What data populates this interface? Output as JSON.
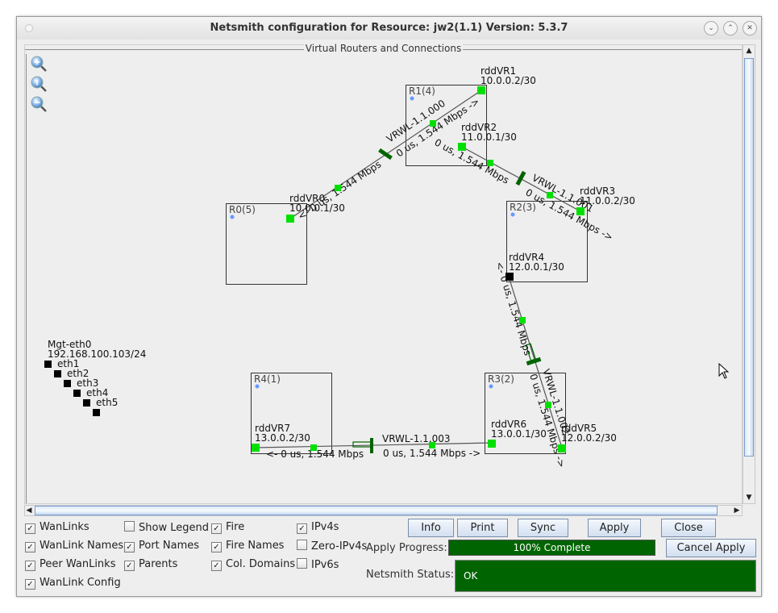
{
  "window": {
    "title": "Netsmith configuration for Resource:  jw2(1.1)  Version: 5.3.7",
    "controls": [
      "minimize",
      "maximize",
      "close"
    ],
    "control_glyphs": [
      "⌄",
      "⌃",
      "✕"
    ]
  },
  "panel": {
    "title": "Virtual Routers and Connections",
    "zoom_tools": [
      "zoom-in",
      "zoom-reset",
      "zoom-out"
    ]
  },
  "routers": [
    {
      "label": "R1(4)"
    },
    {
      "label": "R0(5)"
    },
    {
      "label": "R2(3)"
    },
    {
      "label": "R3(2)"
    },
    {
      "label": "R4(1)"
    }
  ],
  "ports": [
    {
      "name": "rddVR1",
      "ip": "10.0.0.2/30"
    },
    {
      "name": "rddVR2",
      "ip": "11.0.0.1/30"
    },
    {
      "name": "rddVR0",
      "ip": "10.0.0.1/30"
    },
    {
      "name": "rddVR3",
      "ip": "11.0.0.2/30"
    },
    {
      "name": "rddVR4",
      "ip": "12.0.0.1/30"
    },
    {
      "name": "rddVR6",
      "ip": "13.0.0.1/30"
    },
    {
      "name": "rddVR5",
      "ip": "12.0.0.2/30"
    },
    {
      "name": "rddVR7",
      "ip": "13.0.0.2/30"
    }
  ],
  "wanlinks": [
    {
      "name": "VRWL-1.1.000",
      "fwd": "0 us, 1.544 Mbps ->",
      "rev": "<- 0 us, 1.544 Mbps"
    },
    {
      "name": "VRWL-1.1.001",
      "fwd": "0 us, 1.544 Mbps ->",
      "rev": "0 us, 1.544 Mbps"
    },
    {
      "name": "VRWL-1.1.002",
      "fwd": "0 us, 1.544 Mbps ->",
      "rev": "<- 0 us, 1.544 Mbps"
    },
    {
      "name": "VRWL-1.1.003",
      "fwd": "0 us, 1.544 Mbps ->",
      "rev": "<- 0 us, 1.544 Mbps"
    }
  ],
  "mgmt": {
    "name": "Mgt-eth0",
    "ip": "192.168.100.103/24",
    "interfaces": [
      "eth1",
      "eth2",
      "eth3",
      "eth4",
      "eth5"
    ]
  },
  "checkboxes": [
    {
      "label": "WanLinks",
      "checked": true
    },
    {
      "label": "WanLink Names",
      "checked": true
    },
    {
      "label": "Peer WanLinks",
      "checked": true
    },
    {
      "label": "WanLink Config",
      "checked": true
    },
    {
      "label": "Show Legend",
      "checked": false
    },
    {
      "label": "Port Names",
      "checked": true
    },
    {
      "label": "Parents",
      "checked": true
    },
    {
      "label": "Fire",
      "checked": true
    },
    {
      "label": "Fire Names",
      "checked": true
    },
    {
      "label": "Col. Domains",
      "checked": true
    },
    {
      "label": "IPv4s",
      "checked": true
    },
    {
      "label": "Zero-IPv4s",
      "checked": false
    },
    {
      "label": "IPv6s",
      "checked": false
    }
  ],
  "buttons": {
    "info": "Info",
    "print": "Print",
    "sync": "Sync",
    "apply": "Apply",
    "close": "Close",
    "cancel_apply": "Cancel Apply"
  },
  "progress": {
    "label": "Apply Progress:",
    "value_percent": 100,
    "text": "100% Complete"
  },
  "status": {
    "label": "Netsmith Status:",
    "value": "OK"
  },
  "colors": {
    "port_active": "#00e000",
    "port_inactive": "#000000",
    "wanlink_bar": "#006400",
    "status_bg": "#006400",
    "router_dot": "#6699ff"
  }
}
